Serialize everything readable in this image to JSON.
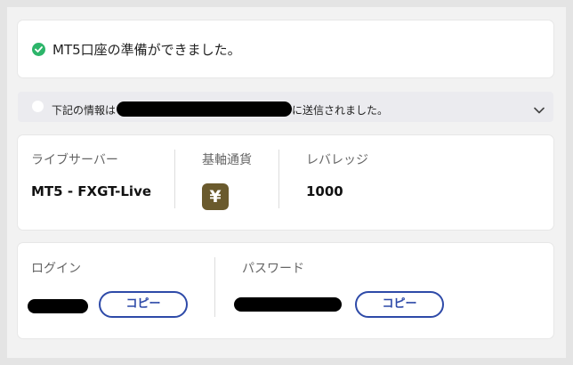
{
  "success_banner": {
    "icon": "check-circle-icon",
    "message": "MT5口座の準備ができました。"
  },
  "info_bar": {
    "icon": "info-icon",
    "text_before": "下記の情報は",
    "text_after": "に送信されました。",
    "expand_icon": "chevron-down-icon"
  },
  "account_info": {
    "server_label": "ライブサーバー",
    "server_value": "MT5 - FXGT-Live",
    "currency_label": "基軸通貨",
    "currency_symbol": "¥",
    "currency_icon_color": "#6a5a2d",
    "leverage_label": "レバレッジ",
    "leverage_value": "1000"
  },
  "credentials": {
    "login_label": "ログイン",
    "password_label": "パスワード",
    "copy_label": "コピー",
    "accent_color": "#2e4aa8"
  }
}
